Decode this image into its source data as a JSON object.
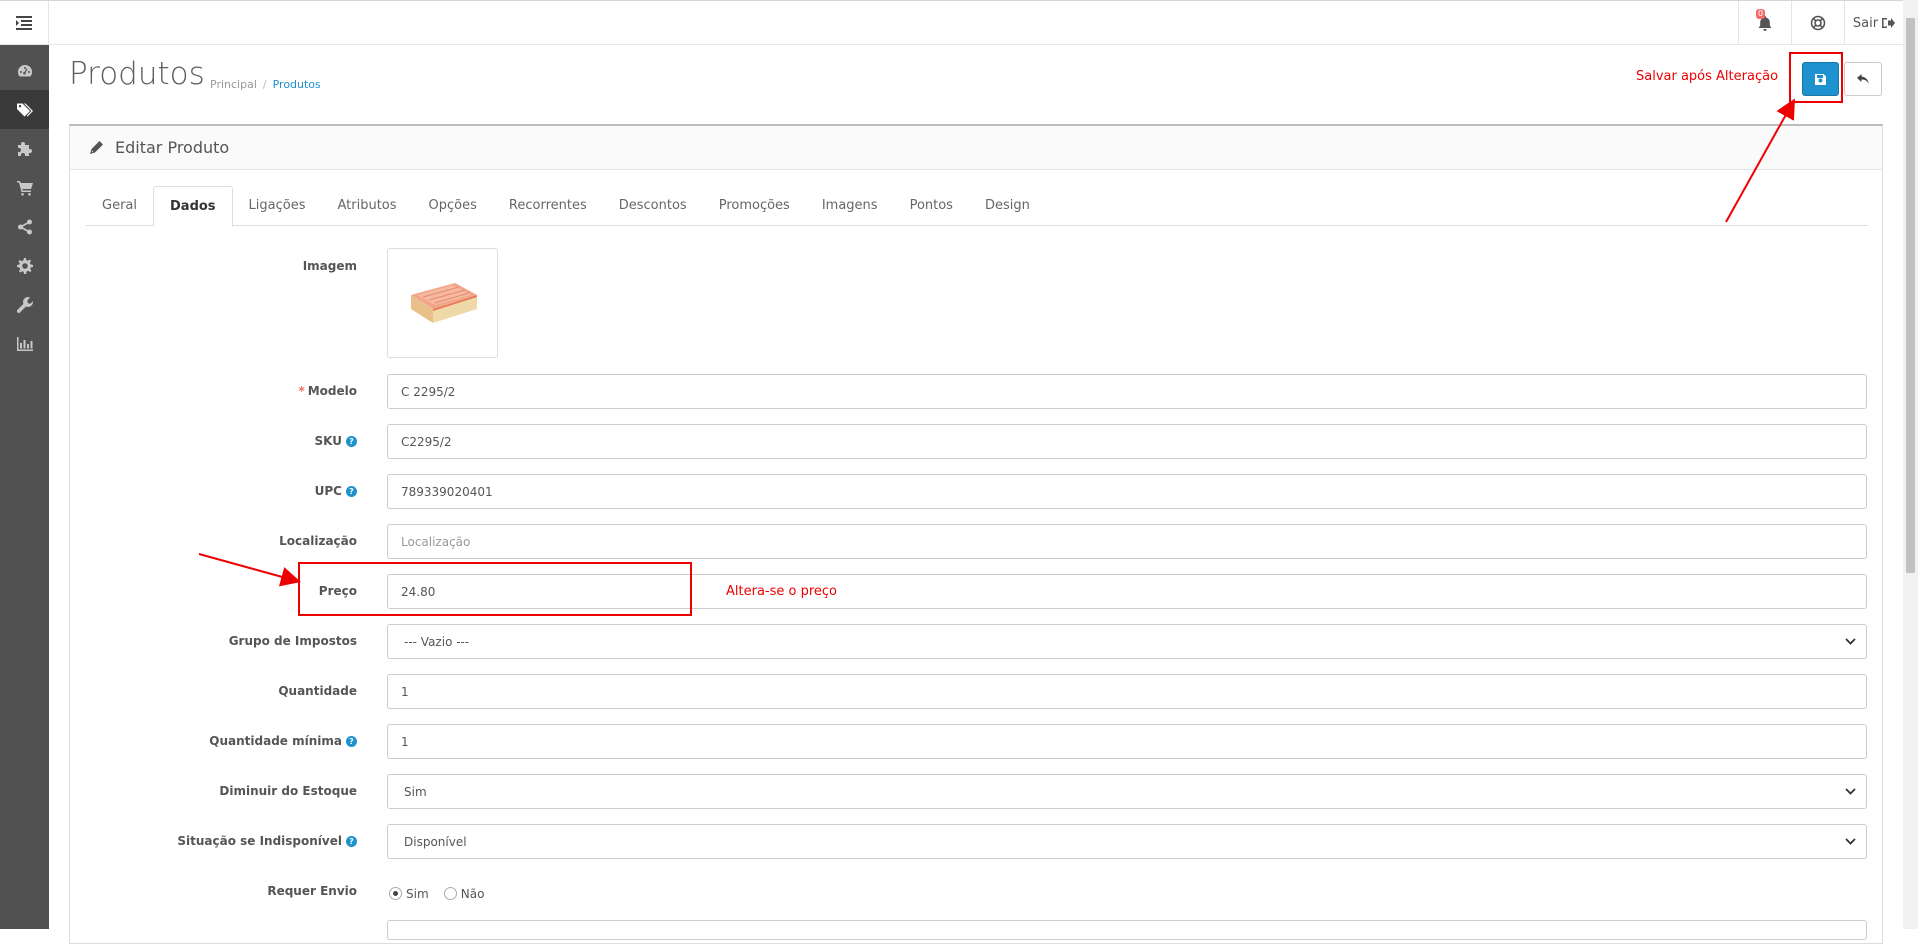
{
  "header": {
    "notification_count": "0",
    "logout_label": "Sair"
  },
  "sidebar": {
    "items": [
      {
        "icon": "dashboard-icon",
        "active": false
      },
      {
        "icon": "tags-icon",
        "active": true
      },
      {
        "icon": "puzzle-icon",
        "active": false
      },
      {
        "icon": "cart-icon",
        "active": false
      },
      {
        "icon": "share-icon",
        "active": false
      },
      {
        "icon": "gear-icon",
        "active": false
      },
      {
        "icon": "wrench-icon",
        "active": false
      },
      {
        "icon": "bar-chart-icon",
        "active": false
      }
    ]
  },
  "page": {
    "title": "Produtos",
    "breadcrumb": [
      "Principal",
      "Produtos"
    ],
    "panel_title": "Editar Produto"
  },
  "tabs": [
    "Geral",
    "Dados",
    "Ligações",
    "Atributos",
    "Opções",
    "Recorrentes",
    "Descontos",
    "Promoções",
    "Imagens",
    "Pontos",
    "Design"
  ],
  "active_tab": "Dados",
  "form": {
    "image_label": "Imagem",
    "model_label": "Modelo",
    "model_value": "C 2295/2",
    "sku_label": "SKU",
    "sku_value": "C2295/2",
    "upc_label": "UPC",
    "upc_value": "789339020401",
    "location_label": "Localização",
    "location_placeholder": "Localização",
    "price_label": "Preço",
    "price_value": "24.80",
    "tax_label": "Grupo de Impostos",
    "tax_value": "--- Vazio ---",
    "quantity_label": "Quantidade",
    "quantity_value": "1",
    "min_quantity_label": "Quantidade mínima",
    "min_quantity_value": "1",
    "subtract_label": "Diminuir do Estoque",
    "subtract_value": "Sim",
    "stock_status_label": "Situação se Indisponível",
    "stock_status_value": "Disponível",
    "shipping_label": "Requer Envio",
    "shipping_yes": "Sim",
    "shipping_no": "Não"
  },
  "annotations": {
    "save_note": "Salvar após Alteração",
    "price_note": "Altera-se o preço",
    "color": "#e00000"
  },
  "colors": {
    "primary": "#1e91cf",
    "sidebar": "#515151",
    "required": "#f56b6b"
  }
}
